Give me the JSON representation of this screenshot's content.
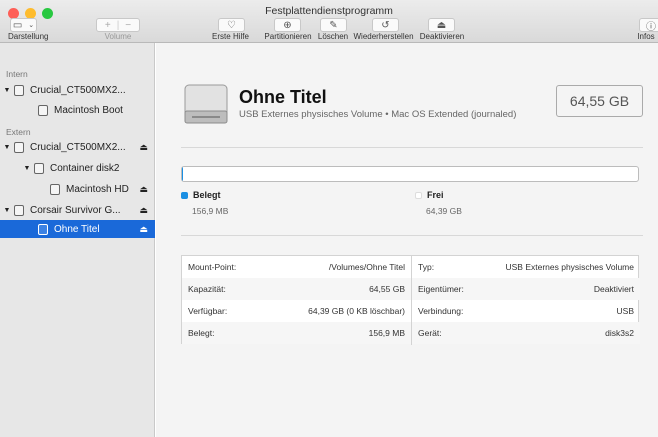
{
  "window": {
    "title": "Festplattendienstprogramm"
  },
  "colors": {
    "accent": "#1a69d9",
    "used": "#1a8fe3",
    "free": "#ffffff",
    "close": "#fe5f57",
    "minimize": "#febc2e",
    "zoom": "#28c840"
  },
  "toolbar": {
    "view_label": "Darstellung",
    "volume_label": "Volume",
    "first_aid_label": "Erste Hilfe",
    "partition_label": "Partitionieren",
    "erase_label": "Löschen",
    "restore_label": "Wiederherstellen",
    "deactivate_label": "Deaktivieren",
    "info_label": "Infos"
  },
  "sidebar": {
    "section_internal": "Intern",
    "section_external": "Extern",
    "items": [
      {
        "label": "Crucial_CT500MX2..."
      },
      {
        "label": "Macintosh Boot"
      },
      {
        "label": "Crucial_CT500MX2..."
      },
      {
        "label": "Container disk2"
      },
      {
        "label": "Macintosh HD"
      },
      {
        "label": "Corsair Survivor G..."
      },
      {
        "label": "Ohne Titel"
      }
    ]
  },
  "volume": {
    "name": "Ohne Titel",
    "subtitle": "USB Externes physisches Volume • Mac OS Extended (journaled)",
    "size": "64,55 GB"
  },
  "usage": {
    "used_fraction": 0.0024,
    "used_label": "Belegt",
    "used_value": "156,9 MB",
    "free_label": "Frei",
    "free_value": "64,39 GB"
  },
  "details": {
    "left": [
      {
        "label": "Mount-Point:",
        "value": "/Volumes/Ohne Titel"
      },
      {
        "label": "Kapazität:",
        "value": "64,55 GB"
      },
      {
        "label": "Verfügbar:",
        "value": "64,39 GB (0 KB löschbar)"
      },
      {
        "label": "Belegt:",
        "value": "156,9 MB"
      }
    ],
    "right": [
      {
        "label": "Typ:",
        "value": "USB Externes physisches Volume"
      },
      {
        "label": "Eigentümer:",
        "value": "Deaktiviert"
      },
      {
        "label": "Verbindung:",
        "value": "USB"
      },
      {
        "label": "Gerät:",
        "value": "disk3s2"
      }
    ]
  }
}
